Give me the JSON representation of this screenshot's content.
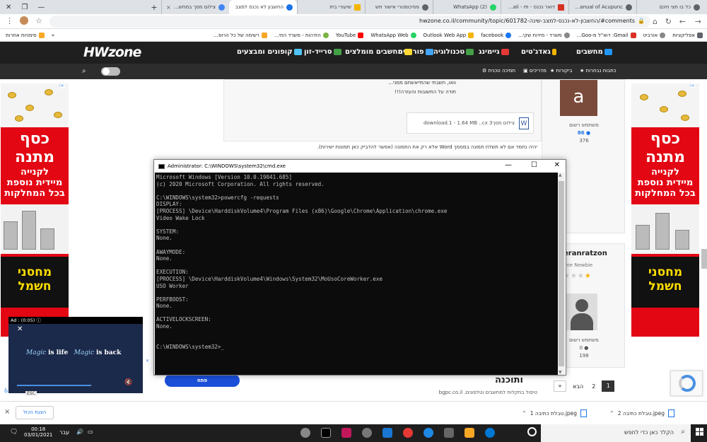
{
  "browser": {
    "tabs": [
      {
        "title": "כל בו חצי חינם"
      },
      {
        "title": "A Manual of Acupunc"
      },
      {
        "title": "דואר נכנס - Gmail - m"
      },
      {
        "title": "(2) WhatsApp"
      },
      {
        "title": "פסיכומטרי אישור תש"
      },
      {
        "title": "שיעורי בית"
      },
      {
        "title": "החשבון לא נכנס למצב"
      },
      {
        "title": "צילום מסך במחשב - ...",
        "x": "×"
      }
    ],
    "new_tab": "+",
    "url": "hwzone.co.il/community/topic/601782-החשבון-לא-נכנס-למצב-שינה/#comments",
    "bookmarks": [
      "אפליקציות",
      "אורביט",
      "Gmail: דוא\"ל מ-Goo...",
      "משרד - מידות שקי...",
      "facebook",
      "Outlook Web App",
      "WhatsApp Web",
      "YouTube",
      "הזדהות - משרד החי...",
      "רשימה של כל הרופ..."
    ],
    "bookmarks_other": "סימניות אחרות",
    "bookmarks_more": "»"
  },
  "site": {
    "logo": "HWzone",
    "nav": [
      "מחשבים",
      "גאדג'טים",
      "גיימינג",
      "טכנולוגיה",
      "פורומים",
      "מחשבים מומלצים",
      "סרייד-זון",
      "קופונים ומבצעים"
    ],
    "nav2": [
      "כתבות נבחרות",
      "ביקורות",
      "מדריכים",
      "תמיכה טכנית"
    ],
    "post_text_1": "וואו, חשבתי שהתייאשתם ממני...",
    "post_text_2": "תודה על התשובות והעזרה!!!",
    "attachment_name": "צילום מסך3 download.1 - 1.64 MB ..cx",
    "attachment_note": "יהיה נחמד אם לא תשלח תמונה במסמך Word אלא רק את התמונה (אפשר להדביק כאן תמונות ישירות).",
    "user1": {
      "initial": "a",
      "role": "משתמש רשום",
      "rep": "86",
      "posts": "376"
    },
    "user2": {
      "name": "eranratzon",
      "rank": "one Newbie",
      "role": "משתמש רשום",
      "rep": "0",
      "posts": "198"
    },
    "pagination": {
      "current": "1",
      "next_page": "2",
      "next": "הבא",
      "last": "»"
    },
    "bottom_title": "ותוכנה",
    "bottom_sub": "טיפול בתקלות למחשבים וטלפונים. bgpc.co.il",
    "bottom_button": "פתח"
  },
  "ads": {
    "headline": "כסף מתנה",
    "sub1": "לקנייה",
    "sub2": "מיידית נוספת",
    "sub3": "בכל המחלקות",
    "brand": "מחסני חשמל"
  },
  "video_ad": {
    "label": "Ad : (0:05)",
    "tagline_a": "Magic",
    "tagline_b": "is life",
    "tagline_c": "Magic",
    "tagline_d": "is back",
    "esc": "ESC"
  },
  "cmd": {
    "title": "Administrator: C:\\WINDOWS\\system32\\cmd.exe",
    "lines": [
      "Microsoft Windows [Version 10.0.19041.685]",
      "(c) 2020 Microsoft Corporation. All rights reserved.",
      "",
      "C:\\WINDOWS\\system32>powercfg -requests",
      "DISPLAY:",
      "[PROCESS] \\Device\\HarddiskVolume4\\Program Files (x86)\\Google\\Chrome\\Application\\chrome.exe",
      "Video Wake Lock",
      "",
      "SYSTEM:",
      "None.",
      "",
      "AWAYMODE:",
      "None.",
      "",
      "EXECUTION:",
      "[PROCESS] \\Device\\HarddiskVolume4\\Windows\\System32\\MoUsoCoreWorker.exe",
      "USO Worker",
      "",
      "PERFBOOST:",
      "None.",
      "",
      "ACTIVELOCKSCREEN:",
      "None.",
      "",
      "",
      "C:\\WINDOWS\\system32>_"
    ]
  },
  "downloads": {
    "items": [
      "טבלת כתיבה 2.jpeg",
      "טבלת כתיבה 1.jpeg"
    ],
    "show_all": "הצגת הכול",
    "close": "×"
  },
  "taskbar": {
    "search": "הקלד כאן כדי לחפש",
    "time": "00:18",
    "date": "03/01/2021",
    "lang": "עבר"
  }
}
